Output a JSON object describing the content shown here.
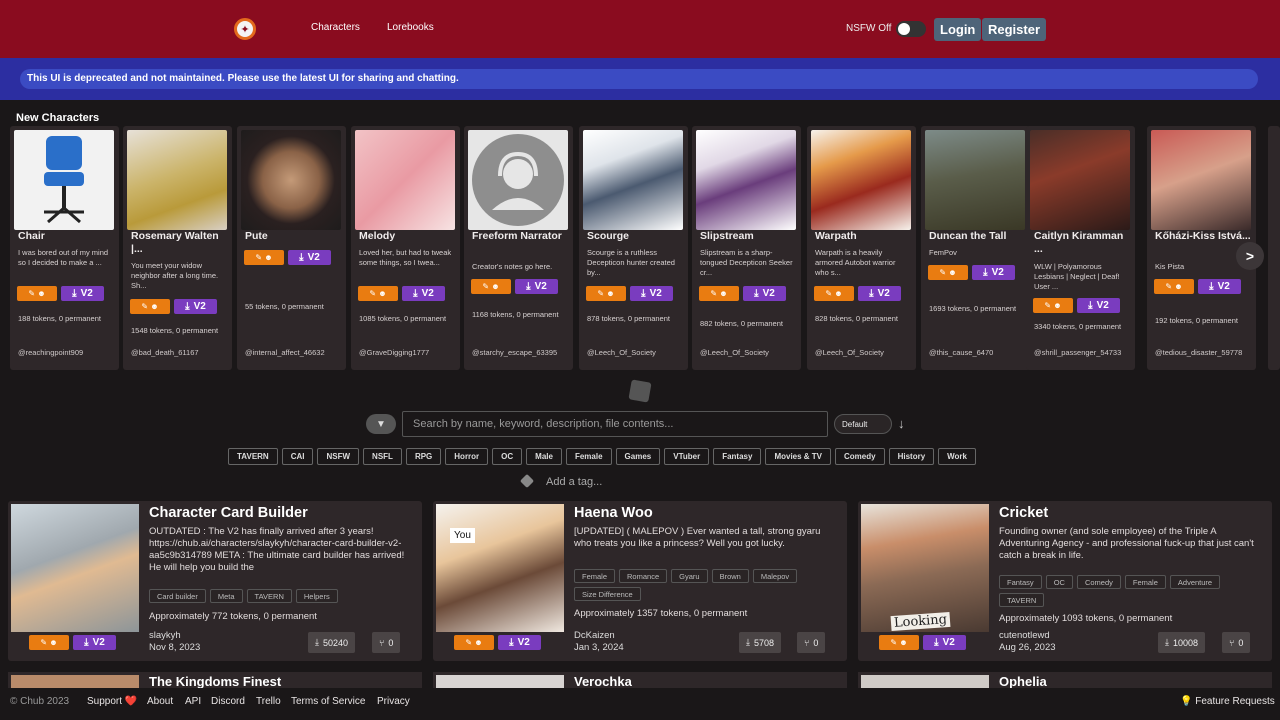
{
  "header": {
    "nav": [
      "Characters",
      "Lorebooks"
    ],
    "nsfw_label": "NSFW Off",
    "login": "Login",
    "register": "Register"
  },
  "banner": "This UI is deprecated and not maintained. Please use the latest UI for sharing and chatting.",
  "new_characters": {
    "title": "New Characters",
    "cards": [
      {
        "name": "Chair",
        "desc": "I was bored out of my mind so I decided to make a ...",
        "tokens": "188 tokens, 0 permanent",
        "user": "@reachingpoint909"
      },
      {
        "name": "Rosemary Walten |...",
        "desc": "You meet your widow neighbor after a long time. Sh...",
        "tokens": "1548 tokens, 0 permanent",
        "user": "@bad_death_61167"
      },
      {
        "name": "Pute",
        "desc": "",
        "tokens": "55 tokens, 0 permanent",
        "user": "@internal_affect_46632"
      },
      {
        "name": "Melody",
        "desc": "Loved her, but had to tweak some things, so I twea...",
        "tokens": "1085 tokens, 0 permanent",
        "user": "@GraveDigging1777"
      },
      {
        "name": "Freeform Narrator",
        "desc": "Creator's notes go here.",
        "tokens": "1168 tokens, 0 permanent",
        "user": "@starchy_escape_63395"
      },
      {
        "name": "Scourge",
        "desc": "Scourge is a ruthless Decepticon hunter created by...",
        "tokens": "878 tokens, 0 permanent",
        "user": "@Leech_Of_Society"
      },
      {
        "name": "Slipstream",
        "desc": "Slipstream is a sharp-tongued Decepticon Seeker cr...",
        "tokens": "882 tokens, 0 permanent",
        "user": "@Leech_Of_Society"
      },
      {
        "name": "Warpath",
        "desc": "Warpath is a heavily armored Autobot warrior who s...",
        "tokens": "828 tokens, 0 permanent",
        "user": "@Leech_Of_Society"
      },
      {
        "name": "Duncan the Tall",
        "desc": "FemPov",
        "tokens": "1693 tokens, 0 permanent",
        "user": "@this_cause_6470"
      },
      {
        "name": "Caitlyn Kiramman ...",
        "desc": "WLW | Polyamorous Lesbians | Neglect | Deaf! User ...",
        "tokens": "3340 tokens, 0 permanent",
        "user": "@shrill_passenger_54733"
      },
      {
        "name": "Kőházi-Kiss Istvá...",
        "desc": "Kis Pista",
        "tokens": "192 tokens, 0 permanent",
        "user": "@tedious_disaster_59778"
      }
    ],
    "next_label": ">",
    "badge_label": "V2"
  },
  "search": {
    "placeholder": "Search by name, keyword, description, file contents...",
    "sort": "Default"
  },
  "tags": [
    "TAVERN",
    "CAI",
    "NSFW",
    "NSFL",
    "RPG",
    "Horror",
    "OC",
    "Male",
    "Female",
    "Games",
    "VTuber",
    "Fantasy",
    "Movies & TV",
    "Comedy",
    "History",
    "Work"
  ],
  "add_tag": "Add a tag...",
  "results": [
    {
      "title": "Character Card Builder",
      "desc": "OUTDATED : The V2 has finally arrived after 3 years! https://chub.ai/characters/slaykyh/character-card-builder-v2-aa5c9b314789 META : The ultimate card builder has arrived! He will help you build the",
      "tags": [
        "Card builder",
        "Meta",
        "TAVERN",
        "Helpers"
      ],
      "tokens": "Approximately 772 tokens, 0 permanent",
      "author": "slaykyh",
      "date": "Nov 8, 2023",
      "downloads": "50240",
      "forks": "0"
    },
    {
      "title": "Haena Woo",
      "desc": "[UPDATED] ( MALEPOV ) Ever wanted a tall, strong gyaru who treats you like a princess? Well you got lucky.",
      "tags": [
        "Female",
        "Romance",
        "Gyaru",
        "Brown",
        "Malepov",
        "Size Difference"
      ],
      "tokens": "Approximately 1357 tokens, 0 permanent",
      "author": "DcKaizen",
      "date": "Jan 3, 2024",
      "downloads": "5708",
      "forks": "0"
    },
    {
      "title": "Cricket",
      "desc": "Founding owner (and sole employee) of the Triple A Adventuring Agency - and professional fuck-up that just can't catch a break in life.",
      "tags": [
        "Fantasy",
        "OC",
        "Comedy",
        "Female",
        "Adventure",
        "TAVERN"
      ],
      "tokens": "Approximately 1093 tokens, 0 permanent",
      "author": "cutenotlewd",
      "date": "Aug 26, 2023",
      "downloads": "10008",
      "forks": "0"
    }
  ],
  "peek": [
    "The Kingdoms Finest",
    "Verochka",
    "Ophelia"
  ],
  "image_labels": {
    "you": "You",
    "looking": "Looking"
  },
  "footer": {
    "copyright": "© Chub 2023",
    "links": [
      "Support ❤️",
      "About",
      "API",
      "Discord",
      "Trello",
      "Terms of Service",
      "Privacy"
    ],
    "feature": "💡 Feature Requests"
  }
}
